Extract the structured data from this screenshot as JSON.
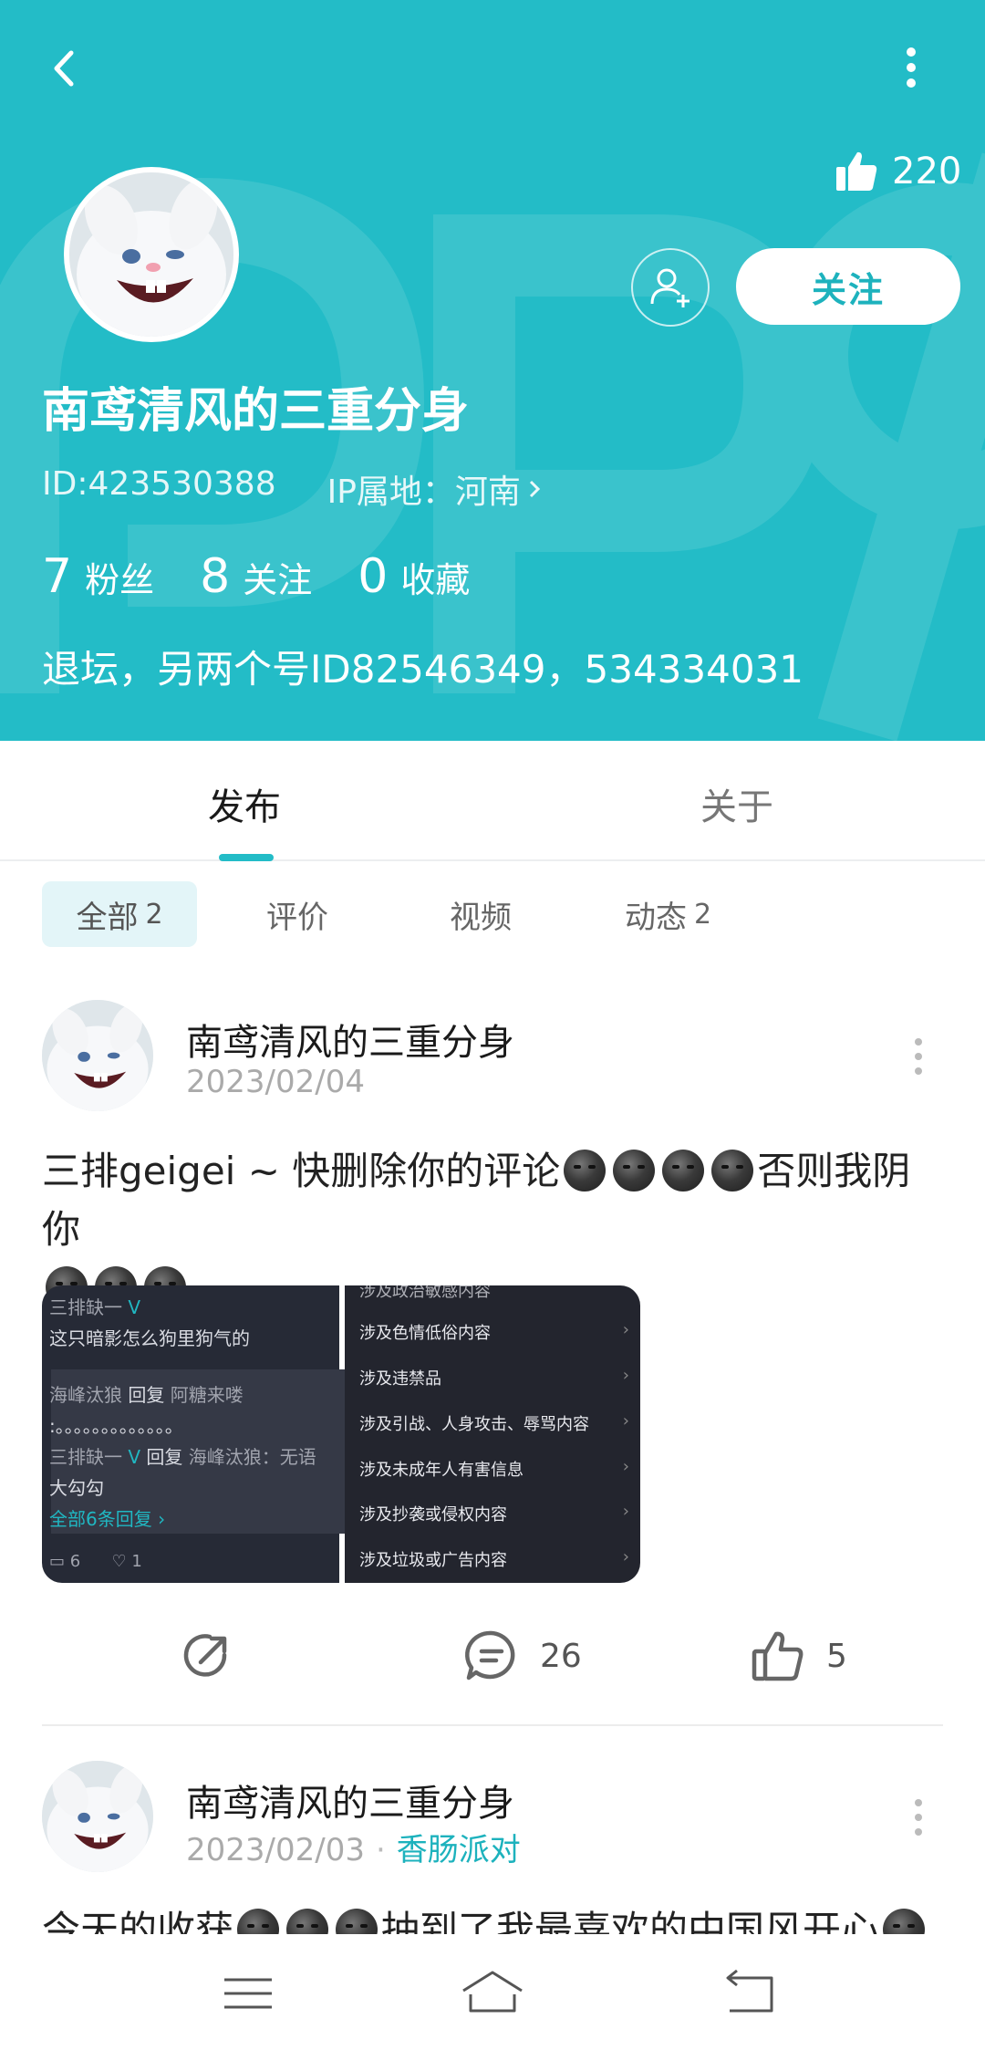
{
  "header": {
    "likes": "220",
    "follow_label": "关注",
    "user_name": "南鸢清风的三重分身",
    "id_text": "ID:423530388",
    "ip_text": "IP属地：河南",
    "stats": [
      {
        "num": "7",
        "label": "粉丝"
      },
      {
        "num": "8",
        "label": "关注"
      },
      {
        "num": "0",
        "label": "收藏"
      }
    ],
    "bio": "退坛，另两个号ID82546349，534334031"
  },
  "tabs": [
    {
      "label": "发布",
      "active": true
    },
    {
      "label": "关于",
      "active": false
    }
  ],
  "subtabs": [
    {
      "label": "全部",
      "count": "2",
      "active": true
    },
    {
      "label": "评价",
      "count": "",
      "active": false
    },
    {
      "label": "视频",
      "count": "",
      "active": false
    },
    {
      "label": "动态",
      "count": "2",
      "active": false
    }
  ],
  "posts": [
    {
      "author": "南鸢清风的三重分身",
      "date": "2023/02/04",
      "text_a": "三排geigei ~ 快删除你的评论",
      "text_b": "否则我阴你",
      "image_a": {
        "name": "三排缺一",
        "line1": "这只暗影怎么狗里狗气的",
        "reply_name": "海峰汰狼",
        "reply_word": "回复",
        "reply_target": "阿糖来喽",
        "dots": ":。。。。。。。。。。。。。",
        "reply2_name": "三排缺一",
        "reply2_word": "回复",
        "reply2_target": "海峰汰狼：无语",
        "reply2_text": "大勾勾",
        "all_replies": "全部6条回复 ›",
        "comments": "6",
        "likes": "1"
      },
      "image_b": {
        "rows": [
          "涉及政治敏感内容",
          "涉及色情低俗内容",
          "涉及违禁品",
          "涉及引战、人身攻击、辱骂内容",
          "涉及未成年人有害信息",
          "涉及抄袭或侵权内容",
          "涉及垃圾或广告内容"
        ]
      },
      "comments": "26",
      "likes": "5"
    },
    {
      "author": "南鸢清风的三重分身",
      "date": "2023/02/03",
      "tag": "香肠派对",
      "text_a": "今天的收获",
      "text_b": "抽到了我最喜欢的中国风开心"
    }
  ],
  "colors": {
    "brand": "#23bcc7",
    "accent_text": "#1db2bd",
    "subtab_active_bg": "#e3f5f8"
  },
  "icons": [
    "back-arrow-icon",
    "more-vertical-icon",
    "thumbs-up-icon",
    "add-user-icon",
    "chevron-right-icon",
    "share-icon",
    "comment-icon",
    "like-icon",
    "menu-icon",
    "home-icon",
    "return-icon"
  ]
}
